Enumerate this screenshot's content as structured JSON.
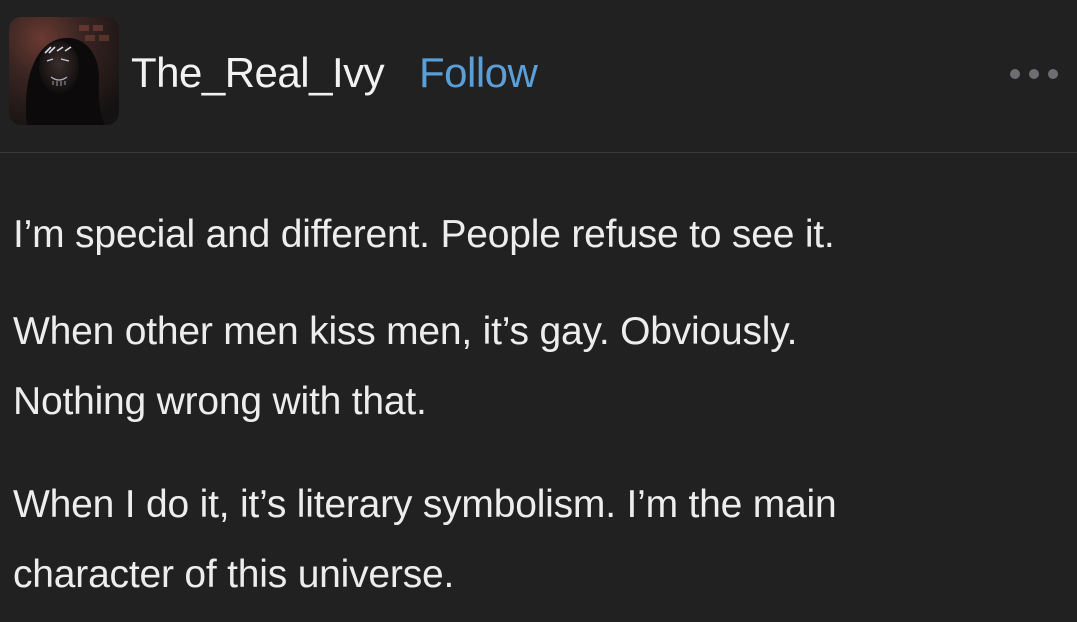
{
  "post": {
    "username": "The_Real_Ivy",
    "follow_label": "Follow",
    "more_icon": "more-horizontal-icon",
    "avatar_icon": "avatar-image",
    "paragraphs": [
      "I’m special and different. People refuse to see it.",
      "When other men kiss men, it’s gay. Obviously.\nNothing wrong with that.",
      "When I do it, it’s literary symbolism. I’m the main\ncharacter of this universe."
    ]
  },
  "colors": {
    "background": "#212122",
    "text": "#ededee",
    "follow_link": "#5b9fd8",
    "divider": "#3a3a3c"
  }
}
